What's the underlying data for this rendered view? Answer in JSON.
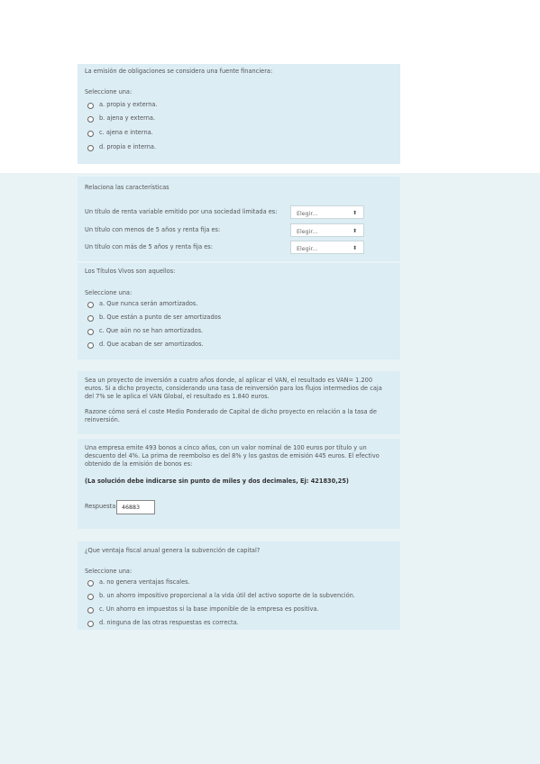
{
  "q1": {
    "prompt": "La emisión de obligaciones se considera una fuente financiera:",
    "select_label": "Seleccione una:",
    "options": [
      "a. propia y externa.",
      "b. ajena y externa.",
      "c. ajena e interna.",
      "d. propia e interna."
    ]
  },
  "q2": {
    "prompt": "Relaciona las características",
    "rows": [
      {
        "label": "Un título de renta variable emitido por una sociedad limitada es:",
        "value": "Elegir..."
      },
      {
        "label": "Un título con menos de 5 años y renta fija es:",
        "value": "Elegir..."
      },
      {
        "label": "Un título con más de 5 años y renta fija es:",
        "value": "Elegir..."
      }
    ]
  },
  "q3": {
    "prompt": "Los Títulos Vivos son aquellos:",
    "select_label": "Seleccione una:",
    "options": [
      "a. Que nunca serán amortizados.",
      "b. Que están a punto de ser amortizados",
      "c. Que aún no se han amortizados.",
      "d. Que acaban de ser amortizados."
    ]
  },
  "q4": {
    "text1": "Sea un proyecto de inversión a cuatro años donde, al aplicar el VAN, el resultado es VAN= 1.200 euros. Si a dicho proyecto, considerando una tasa de reinversión para los flujos intermedios de caja del 7% se le aplica el VAN Global, el resultado es 1.840 euros.",
    "text2": "Razone cómo será el coste Medio Ponderado de Capital de dicho proyecto en relación a la tasa de reinversión."
  },
  "q5": {
    "text": "Una empresa emite 493 bonos a cinco años, con un valor nominal de 100 euros por título y un descuento del 4%. La prima de reembolso es del 8% y los gastos de emisión 445 euros. El efectivo obtenido de la emisión de bonos es:",
    "note": "(La solución debe indicarse sin punto de miles y dos decimales, Ej: 421830,25)",
    "answer_label": "Respuesta:",
    "answer_value": "46883"
  },
  "q6": {
    "prompt": "¿Que ventaja fiscal anual genera la subvención de capital?",
    "select_label": "Seleccione una:",
    "options": [
      "a. no genera ventajas fiscales.",
      "b. un ahorro impositivo proporcional a la vida útil del activo soporte de la subvención.",
      "c. Un ahorro en impuestos si la base imponible de la empresa es positiva.",
      "d. ninguna de las otras respuestas es correcta."
    ]
  }
}
